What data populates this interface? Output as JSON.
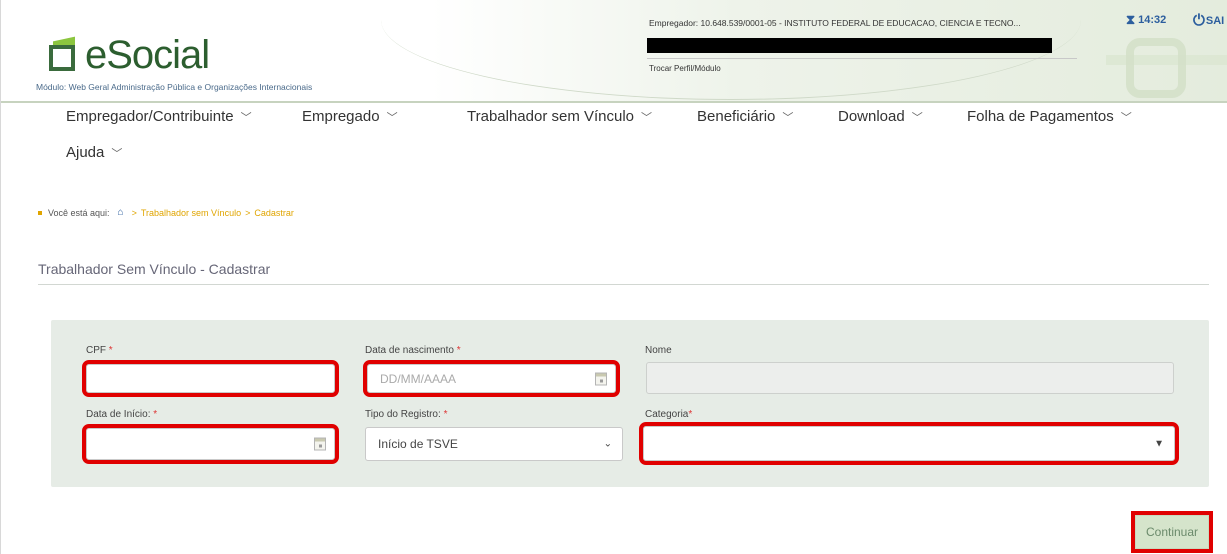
{
  "header": {
    "logo_text": "eSocial",
    "modulo": "Módulo: Web Geral Administração Pública e Organizações Internacionais",
    "empregador": "Empregador: 10.648.539/0001-05 - INSTITUTO FEDERAL DE EDUCACAO, CIENCIA E TECNO...",
    "trocar": "Trocar Perfil/Módulo",
    "time": "14:32",
    "sair": "SAI"
  },
  "nav": {
    "items": [
      {
        "label": "Empregador/Contribuinte"
      },
      {
        "label": "Empregado"
      },
      {
        "label": "Trabalhador sem Vínculo"
      },
      {
        "label": "Beneficiário"
      },
      {
        "label": "Download"
      },
      {
        "label": "Folha de Pagamentos"
      },
      {
        "label": "Ajuda"
      }
    ]
  },
  "breadcrumb": {
    "prefix": "Você está aqui:",
    "items": [
      "Trabalhador sem Vínculo",
      "Cadastrar"
    ]
  },
  "page_title": "Trabalhador Sem Vínculo - Cadastrar",
  "form": {
    "cpf_label": "CPF",
    "cpf_value": "",
    "nascimento_label": "Data de nascimento",
    "nascimento_placeholder": "DD/MM/AAAA",
    "nome_label": "Nome",
    "nome_value": "",
    "inicio_label": "Data de Início:",
    "inicio_value": "",
    "tipo_label": "Tipo do Registro:",
    "tipo_value": "Início de TSVE",
    "categoria_label": "Categoria",
    "categoria_value": "",
    "required_mark": "*"
  },
  "actions": {
    "continuar": "Continuar"
  },
  "colors": {
    "highlight": "#e00000",
    "brand_green": "#2c5e2f",
    "panel_bg": "#e6ece6"
  }
}
